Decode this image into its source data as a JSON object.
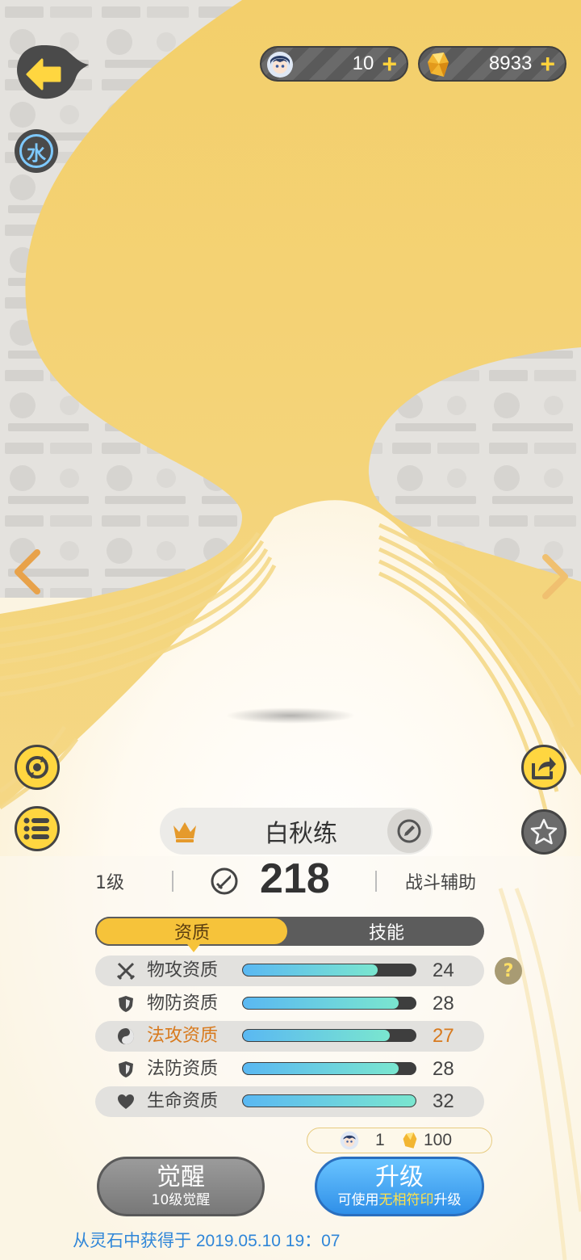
{
  "currencies": [
    {
      "name": "summon-token",
      "value": "10",
      "plus": "+"
    },
    {
      "name": "gold-crystal",
      "value": "8933",
      "plus": "+"
    }
  ],
  "element_badge": "水",
  "pet": {
    "name": "白秋练",
    "level": "1级",
    "power": "218",
    "role": "战斗辅助"
  },
  "tabs": {
    "active": "资质",
    "inactive": "技能"
  },
  "aptitudes": [
    {
      "icon": "swords-icon",
      "label": "物攻资质",
      "value": "24",
      "fill": 0.78,
      "highlight": false
    },
    {
      "icon": "shield-icon",
      "label": "物防资质",
      "value": "28",
      "fill": 0.9,
      "highlight": false
    },
    {
      "icon": "yinyang-icon",
      "label": "法攻资质",
      "value": "27",
      "fill": 0.85,
      "highlight": true
    },
    {
      "icon": "shield-icon",
      "label": "法防资质",
      "value": "28",
      "fill": 0.9,
      "highlight": false
    },
    {
      "icon": "heart-icon",
      "label": "生命资质",
      "value": "32",
      "fill": 1.0,
      "highlight": false
    }
  ],
  "help": "?",
  "cost": {
    "token": "1",
    "crystal": "100"
  },
  "buttons": {
    "awaken_title": "觉醒",
    "awaken_sub": "10级觉醒",
    "upgrade_title": "升级",
    "upgrade_sub_pre": "可使用",
    "upgrade_sub_hl": "无相符印",
    "upgrade_sub_post": "升级"
  },
  "footer": "从灵石中获得于 2019.05.10   19：07",
  "colors": {
    "accent": "#f6c33a",
    "highlight": "#d87a1e",
    "bar": "#5ab8f2",
    "link": "#2f86d8"
  }
}
